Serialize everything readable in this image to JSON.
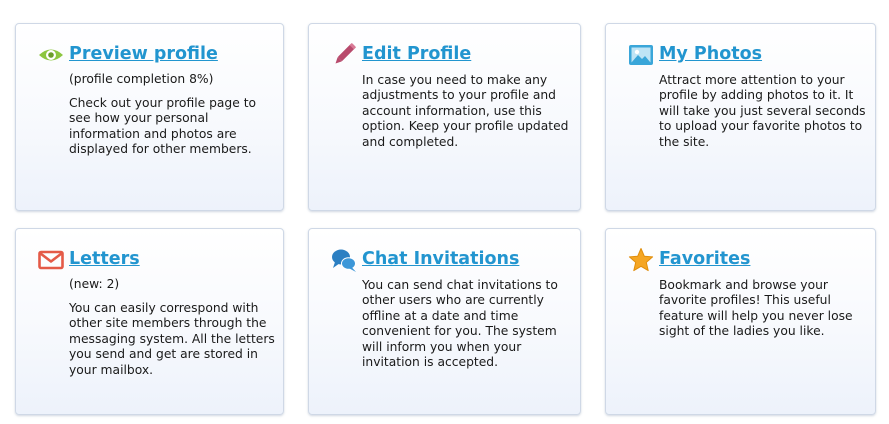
{
  "cards": [
    {
      "title": "Preview profile",
      "subtitle": "(profile completion 8%)",
      "description": "Check out your profile page to see how your personal information and photos are displayed for other members.",
      "icon": "eye-icon",
      "icon_color": "#8cc63f"
    },
    {
      "title": "Edit Profile",
      "subtitle": "",
      "description": "In case you need to make any adjustments to your profile and account information, use this option. Keep your profile updated and completed.",
      "icon": "pencil-icon",
      "icon_color": "#b84a6c"
    },
    {
      "title": "My Photos",
      "subtitle": "",
      "description": "Attract more attention to your profile by adding photos to it. It will take you just several seconds to upload your favorite photos to the site.",
      "icon": "photo-icon",
      "icon_color": "#3aa6d9"
    },
    {
      "title": "Letters",
      "subtitle": "(new: 2)",
      "description": "You can easily correspond with other site members through the messaging system. All the letters you send and get are stored in your mailbox.",
      "icon": "envelope-icon",
      "icon_color": "#e45a47"
    },
    {
      "title": "Chat Invitations",
      "subtitle": "",
      "description": "You can send chat invitations to other users who are currently offline at a date and time convenient for you. The system will inform you when your invitation is accepted.",
      "icon": "chat-bubbles-icon",
      "icon_color": "#2b7fc2"
    },
    {
      "title": "Favorites",
      "subtitle": "",
      "description": "Bookmark and browse your favorite profiles! This useful feature will help you never lose sight of the ladies you like.",
      "icon": "star-icon",
      "icon_color": "#f5a623"
    }
  ],
  "colors": {
    "link": "#2295cf",
    "card_border": "#cfd8e6"
  }
}
